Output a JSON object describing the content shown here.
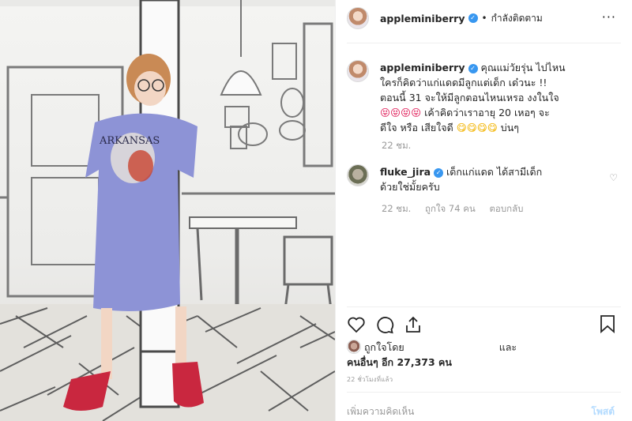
{
  "header": {
    "username": "appleminiberry",
    "separator": "•",
    "following_label": "กำลังติดตาม",
    "more_label": "···"
  },
  "caption": {
    "username": "appleminiberry",
    "line1": "คุณแม่วัยรุ่น ไปไหน",
    "line2": "ใครก็คิดว่าแก่แดดมีลูกแต่เด็ก เด๋วนะ !!",
    "line3": "ตอนนี้ 31 จะให้มีลูกตอนไหนเหรอ งงในใจ",
    "line4_emoji": "😝😝😝😝",
    "line4_text": " เค้าคิดว่าเราอายุ 20 เหอๆ จะ",
    "line5_text": "ดีใจ หรือ เสียใจดี ",
    "line5_emoji": "😋😋😋😋",
    "line5_end": " บ่นๆ",
    "time": "22 ชม."
  },
  "reply": {
    "username": "fluke_jira",
    "line1": "เด็กแก่แดด ได้สามีเด็ก",
    "line2": "ด้วยใช่มั้ยครับ",
    "time": "22 ชม.",
    "likes": "ถูกใจ 74 คน",
    "reply_label": "ตอบกลับ"
  },
  "likes": {
    "liked_by": "ถูกใจโดย",
    "and": "และ",
    "others": "คนอื่นๆ อีก 27,373 คน"
  },
  "timeago": "22 ชั่วโมงที่แล้ว",
  "add_comment_placeholder": "เพิ่มความคิดเห็น",
  "post_label": "โพสต์",
  "verified_mark": "✓",
  "heart_small": "♡",
  "colors": {
    "verified": "#3897f0",
    "post": "#b3dbff",
    "meta": "#999999"
  }
}
